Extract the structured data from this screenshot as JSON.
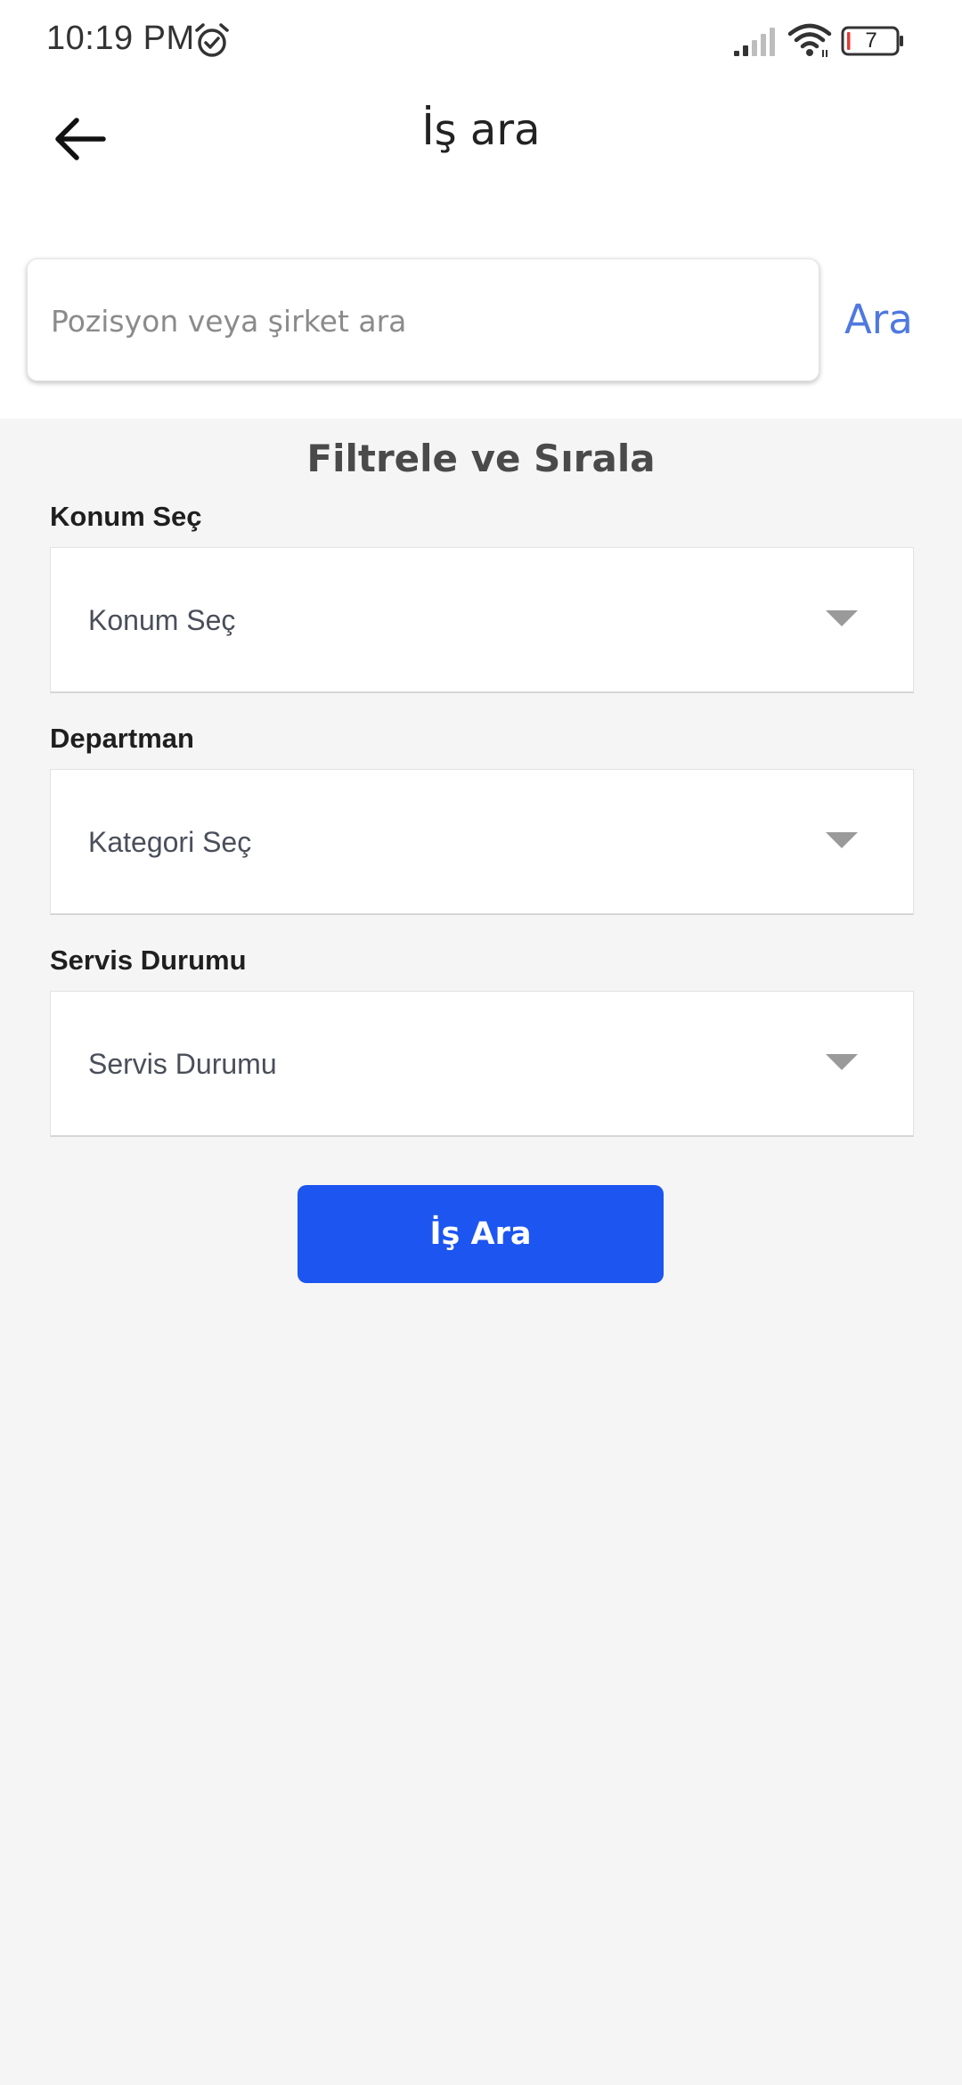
{
  "status_bar": {
    "time": "10:19 PM",
    "battery_level": "7",
    "icons": [
      "alarm-icon",
      "signal-icon",
      "wifi-icon",
      "battery-icon"
    ],
    "battery_low_color": "#e53935"
  },
  "app_bar": {
    "back_icon": "arrow-left-icon",
    "title": "İş ara"
  },
  "search": {
    "placeholder": "Pozisyon veya şirket ara",
    "value": "",
    "action_label": "Ara",
    "action_color": "#4f78e0"
  },
  "filters": {
    "title": "Filtrele ve Sırala",
    "fields": [
      {
        "label": "Konum Seç",
        "selected": "Konum Seç"
      },
      {
        "label": "Departman",
        "selected": "Kategori Seç"
      },
      {
        "label": "Servis Durumu",
        "selected": "Servis Durumu"
      }
    ]
  },
  "submit": {
    "label": "İş Ara",
    "color": "#1d55f0"
  }
}
